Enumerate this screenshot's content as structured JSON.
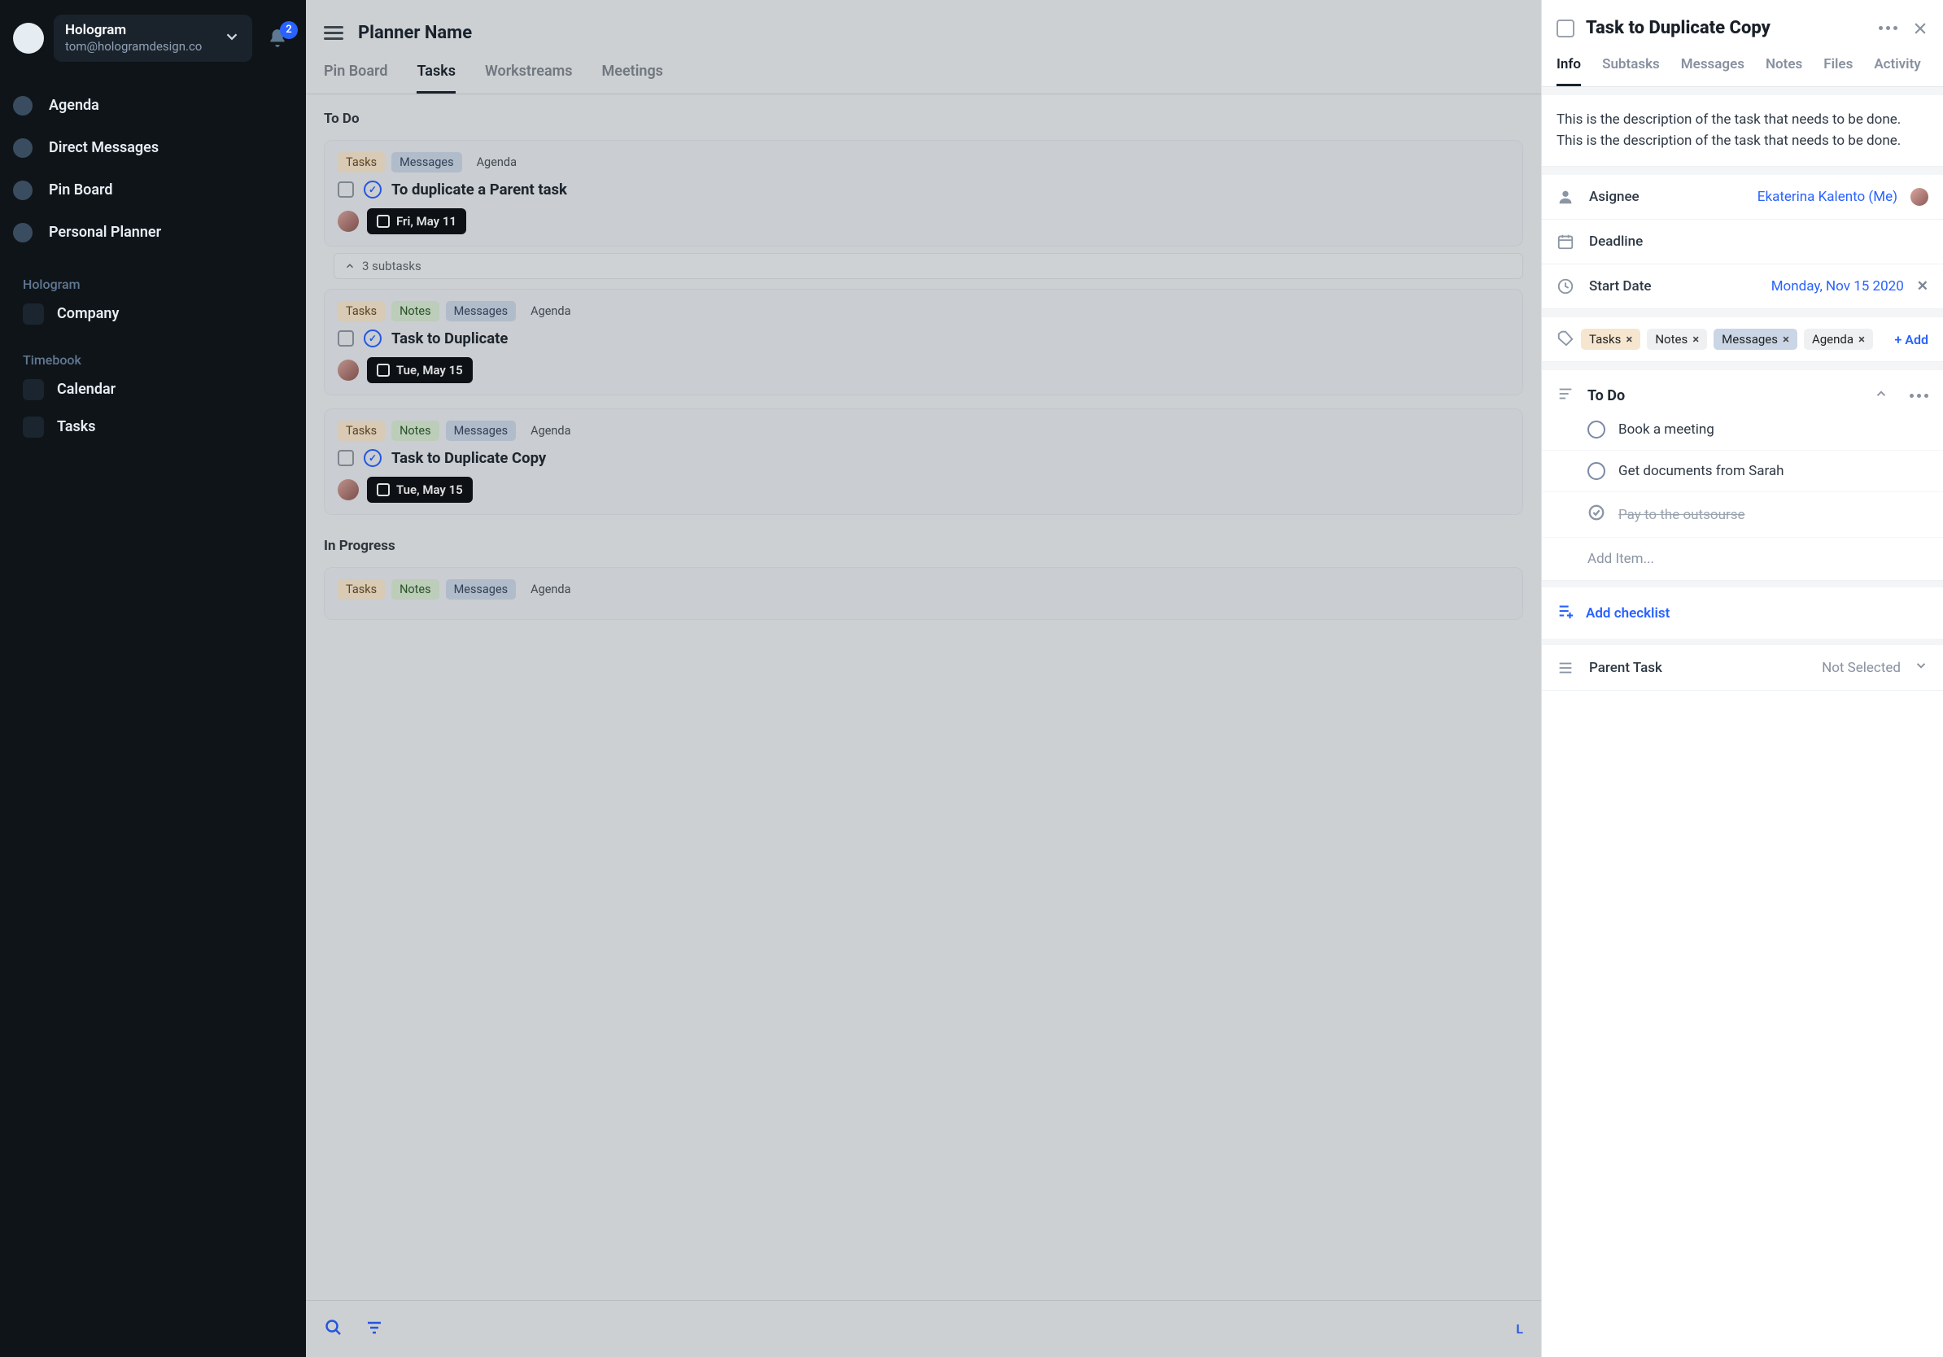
{
  "workspace": {
    "name": "Hologram",
    "email": "tom@hologramdesign.co"
  },
  "notifications": "2",
  "nav": {
    "agenda": "Agenda",
    "dm": "Direct Messages",
    "pinboard": "Pin Board",
    "planner": "Personal Planner"
  },
  "sections": {
    "hologram": {
      "label": "Hologram",
      "company": "Company"
    },
    "timebook": {
      "label": "Timebook",
      "calendar": "Calendar",
      "tasks": "Tasks"
    }
  },
  "main": {
    "title": "Planner Name",
    "tabs": {
      "pin": "Pin Board",
      "tasks": "Tasks",
      "ws": "Workstreams",
      "meet": "Meetings"
    },
    "todo_label": "To Do",
    "inprog_label": "In Progress",
    "chips": {
      "tasks": "Tasks",
      "notes": "Notes",
      "msgs": "Messages",
      "agenda": "Agenda"
    },
    "card1": {
      "title": "To duplicate a Parent task",
      "date": "Fri, May 11",
      "sub": "3 subtasks"
    },
    "card2": {
      "title": "Task to Duplicate",
      "date": "Tue, May 15"
    },
    "card3": {
      "title": "Task to Duplicate Copy",
      "date": "Tue, May 15"
    },
    "footer_trail": "L"
  },
  "panel": {
    "title": "Task to Duplicate Copy",
    "tabs": {
      "info": "Info",
      "subtasks": "Subtasks",
      "messages": "Messages",
      "notes": "Notes",
      "files": "Files",
      "activity": "Activity"
    },
    "desc": "This is the description of the task that needs to be done. This is the description of the task that needs to be done.",
    "assignee_key": "Asignee",
    "assignee_val": "Ekaterina Kalento (Me)",
    "deadline_key": "Deadline",
    "start_key": "Start Date",
    "start_val": "Monday, Nov 15 2020",
    "tags": {
      "tasks": "Tasks",
      "notes": "Notes",
      "msgs": "Messages",
      "agenda": "Agenda"
    },
    "add_tag": "+ Add",
    "todo_label": "To Do",
    "items": {
      "a": "Book a meeting",
      "b": "Get documents from Sarah",
      "c": "Pay to the outsourse"
    },
    "add_item": "Add Item...",
    "add_checklist": "Add checklist",
    "parent_key": "Parent Task",
    "parent_val": "Not Selected"
  }
}
